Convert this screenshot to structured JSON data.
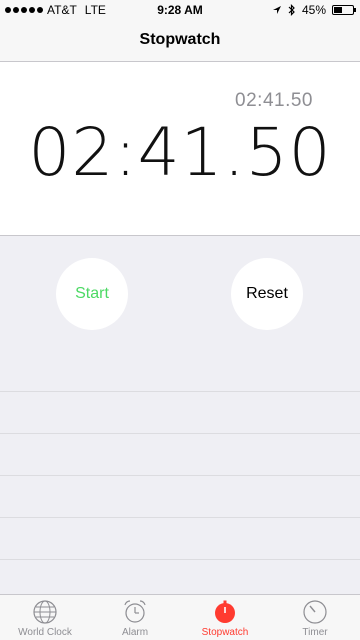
{
  "status_bar": {
    "carrier": "AT&T",
    "network": "LTE",
    "time": "9:28 AM",
    "battery_percent": "45%",
    "battery_level": 0.45,
    "icons": [
      "location-arrow-icon",
      "bluetooth-icon",
      "battery-icon"
    ]
  },
  "nav": {
    "title": "Stopwatch"
  },
  "timer": {
    "lap_time": "02:41.50",
    "main_time": "02:41.50"
  },
  "controls": {
    "start_label": "Start",
    "reset_label": "Reset"
  },
  "tabs": [
    {
      "label": "World Clock",
      "icon": "globe-icon"
    },
    {
      "label": "Alarm",
      "icon": "alarm-clock-icon"
    },
    {
      "label": "Stopwatch",
      "icon": "stopwatch-icon",
      "active": true
    },
    {
      "label": "Timer",
      "icon": "timer-icon"
    }
  ],
  "colors": {
    "accent": "#ff3b30",
    "start_green": "#4cd964",
    "gray": "#8e8e93"
  }
}
